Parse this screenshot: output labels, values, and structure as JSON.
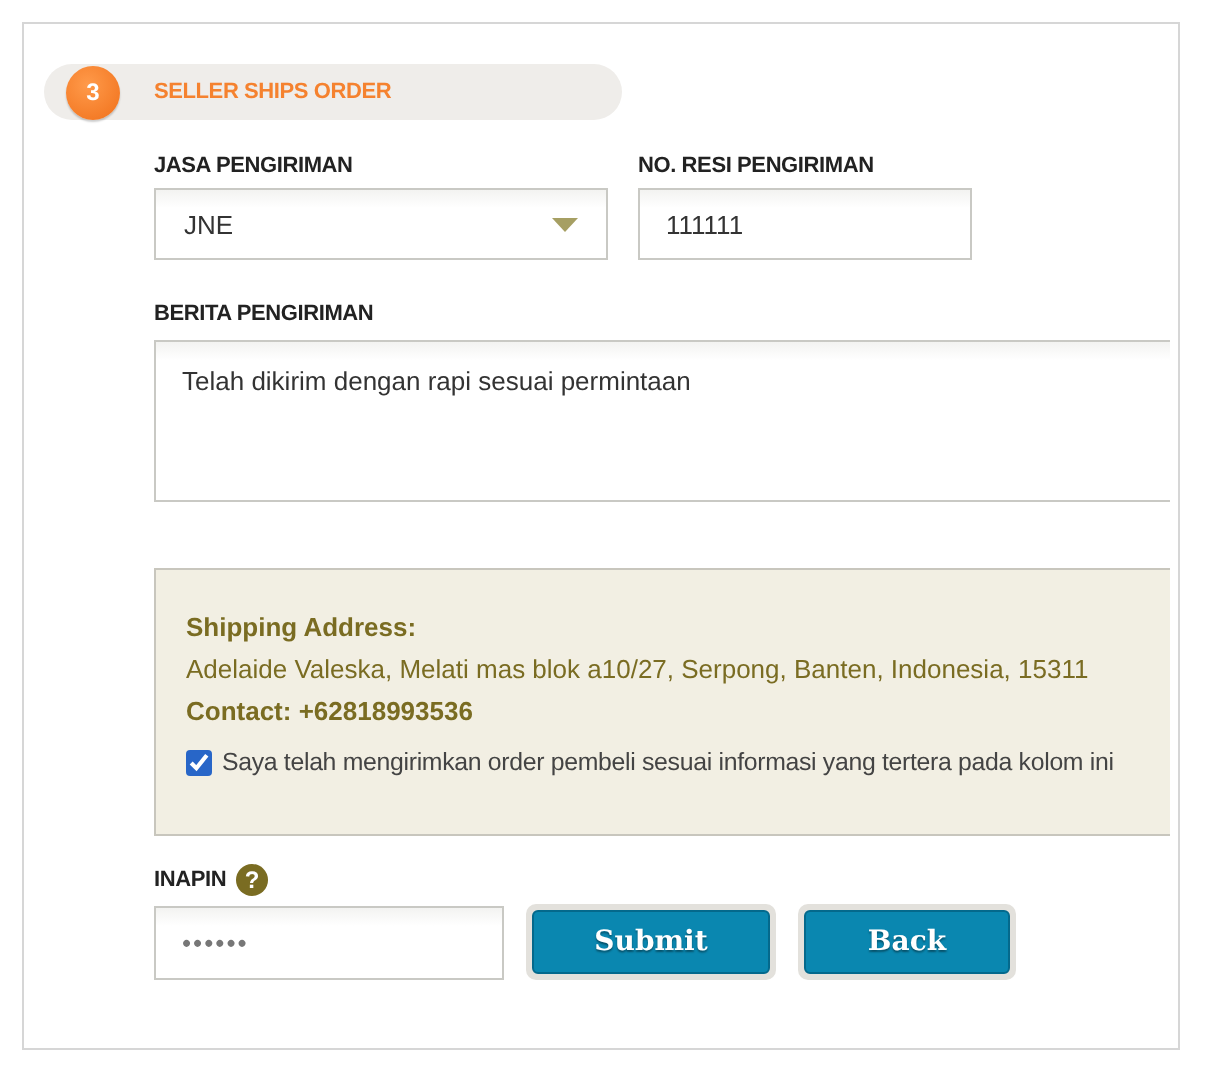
{
  "step": {
    "number": "3",
    "title": "SELLER SHIPS ORDER"
  },
  "courier": {
    "label": "JASA PENGIRIMAN",
    "value": "JNE"
  },
  "receipt": {
    "label": "NO. RESI PENGIRIMAN",
    "value": "111111"
  },
  "message": {
    "label": "BERITA PENGIRIMAN",
    "value": "Telah dikirim dengan rapi sesuai permintaan"
  },
  "address": {
    "heading": "Shipping Address:",
    "line": "Adelaide Valeska, Melati mas blok a10/27, Serpong, Banten, Indonesia, 15311",
    "contact": "Contact: +62818993536"
  },
  "confirm": {
    "label": "Saya telah mengirimkan order pembeli sesuai informasi yang tertera pada kolom ini",
    "checked": true
  },
  "pin": {
    "label": "INAPIN",
    "help": "?",
    "value": "••••••"
  },
  "buttons": [
    {
      "label": "Submit"
    },
    {
      "label": "Back"
    }
  ]
}
